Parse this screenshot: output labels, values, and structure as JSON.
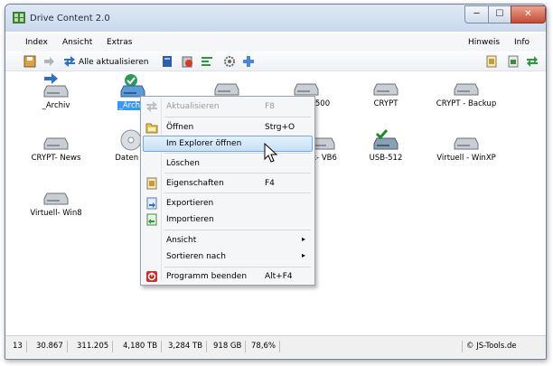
{
  "window": {
    "title": "Drive Content 2.0",
    "min": "─",
    "max": "☐",
    "close": "✕"
  },
  "menubar": {
    "items": [
      "Index",
      "Ansicht",
      "Extras"
    ],
    "right": [
      "Hinweis",
      "Info"
    ]
  },
  "toolbar": {
    "update_all": "Alle aktualisieren"
  },
  "drives": [
    {
      "label": "_Archiv",
      "selected": false
    },
    {
      "label": "_Archiv",
      "selected": true
    },
    {
      "label": "",
      "selected": false
    },
    {
      "label": "500",
      "selected": false
    },
    {
      "label": "CRYPT",
      "selected": false
    },
    {
      "label": "CRYPT - Backup",
      "selected": false
    },
    {
      "label": "CRYPT- News",
      "selected": false
    },
    {
      "label": "Daten 20",
      "selected": false
    },
    {
      "label": "k- VB6",
      "selected": false
    },
    {
      "label": "USB-512",
      "selected": false
    },
    {
      "label": "Virtuell - WinXP",
      "selected": false
    },
    {
      "label": "Virtuell- Win8",
      "selected": false
    }
  ],
  "context_menu": [
    {
      "label": "Aktualisieren",
      "shortcut": "F8",
      "disabled": true,
      "icon": "refresh-icon"
    },
    {
      "label": "Öffnen",
      "shortcut": "Strg+O",
      "icon": "open-folder-icon"
    },
    {
      "label": "Im Explorer öffnen",
      "shortcut": "",
      "highlighted": true
    },
    {
      "label": "Löschen",
      "shortcut": ""
    },
    {
      "label": "Eigenschaften",
      "shortcut": "F4",
      "icon": "properties-icon"
    },
    {
      "label": "Exportieren",
      "shortcut": "",
      "icon": "export-icon"
    },
    {
      "label": "Importieren",
      "shortcut": "",
      "icon": "import-icon"
    },
    {
      "label": "Ansicht",
      "submenu": true
    },
    {
      "label": "Sortieren nach",
      "submenu": true
    },
    {
      "label": "Programm beenden",
      "shortcut": "Alt+F4",
      "icon": "power-icon"
    }
  ],
  "status": [
    "13",
    "30.867",
    "311.205",
    "4,180 TB",
    "3,284 TB",
    "918 GB",
    "78,6%"
  ],
  "status_right": "© JS-Tools.de",
  "colors": {
    "selection": "#3399ff",
    "highlight_border": "#7aa9d9"
  }
}
